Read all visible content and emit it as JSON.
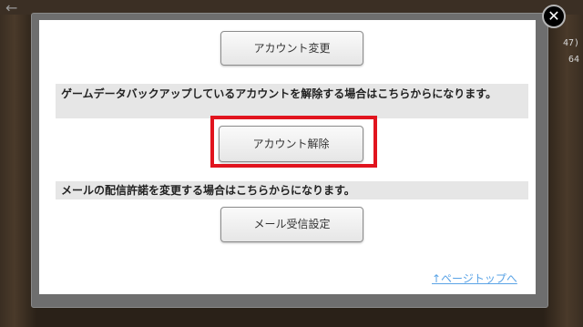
{
  "background": {
    "back_arrow_icon": "arrow-left",
    "side_value_1": "47)",
    "side_value_2": "64"
  },
  "dialog": {
    "close_icon": "close-x",
    "change_account_label": "アカウント変更",
    "backup_notice": "ゲームデータバックアップしているアカウントを解除する場合はこちらからになります。",
    "cancel_account_label": "アカウント解除",
    "mail_notice": "メールの配信許諾を変更する場合はこちらからになります。",
    "mail_settings_label": "メール受信設定",
    "page_top_link": "↑ページトップへ",
    "highlight_color": "#e1141e"
  }
}
